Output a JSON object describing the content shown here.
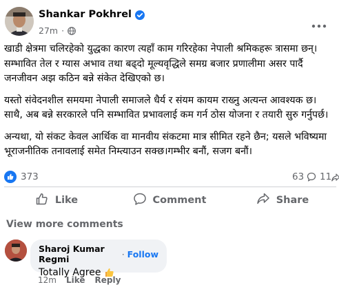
{
  "post": {
    "author": "Shankar Pokhrel",
    "timestamp": "27m",
    "visibility_icon": "globe-icon",
    "paragraphs": [
      "खाडी क्षेत्रमा चलिरहेको युद्धका कारण त्यहाँ काम गरिरहेका नेपाली श्रमिकहरू त्रासमा छन्। सम्भावित तेल र ग्यास अभाव तथा बढ्दो मूल्यवृद्धिले समग्र बजार प्रणालीमा असर पार्दै जनजीवन अझ कठिन बन्ने संकेत देखिएको छ।",
      "यस्तो संवेदनशील समयमा नेपाली समाजले धैर्य र संयम कायम राख्नु अत्यन्त आवश्यक छ। साथै, अब बन्ने सरकारले पनि सम्भावित प्रभावलाई कम गर्न ठोस योजना र तयारी सुरु गर्नुपर्छ।",
      "अन्यथा, यो संकट केवल आर्थिक वा मानवीय संकटमा मात्र सीमित रहने छैन; यसले भविष्यमा भूराजनीतिक तनावलाई समेत निम्त्याउन सक्छ।गम्भीर बनौं, सजग बनौं।"
    ]
  },
  "stats": {
    "reactions": "373",
    "comments": "63",
    "shares": "11"
  },
  "actions": {
    "like": "Like",
    "comment": "Comment",
    "share": "Share"
  },
  "view_more_comments": "View more comments",
  "comment": {
    "author": "Sharoj Kumar Regmi",
    "separator": "·",
    "follow": "Follow",
    "text": "Totally Agree",
    "emoji": "👍",
    "time": "12m",
    "like": "Like",
    "reply": "Reply"
  },
  "colors": {
    "accent": "#1877f2",
    "secondary_text": "#65676b",
    "bubble": "#f0f2f5"
  }
}
